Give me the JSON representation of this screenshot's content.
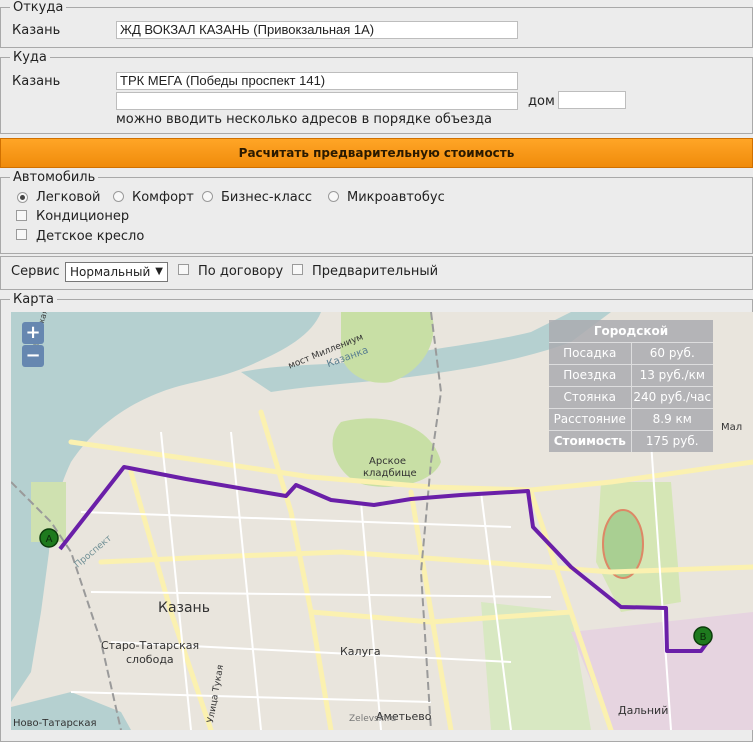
{
  "from": {
    "legend": "Откуда",
    "city": "Казань",
    "address": "ЖД ВОКЗАЛ КАЗАНЬ (Привокзальная 1А)"
  },
  "to": {
    "legend": "Куда",
    "city": "Казань",
    "address": "ТРК МЕГА (Победы проспект 141)",
    "address2": "",
    "house_label": "дом",
    "house_value": "",
    "hint": "можно вводить несколько адресов в порядке объезда"
  },
  "calc_button": "Расчитать предварительную стоимость",
  "car": {
    "legend": "Автомобиль",
    "options": [
      "Легковой",
      "Комфорт",
      "Бизнес-класс",
      "Микроавтобус"
    ],
    "selected": "Легковой",
    "extras": [
      "Кондиционер",
      "Детское кресло"
    ]
  },
  "service": {
    "label": "Сервис",
    "selected": "Нормальный",
    "contract": "По договору",
    "preliminary": "Предварительный"
  },
  "map": {
    "legend": "Карта",
    "zoom_in": "+",
    "zoom_out": "−",
    "tariff": {
      "title": "Городской",
      "rows": [
        {
          "name": "Посадка",
          "value": "60 руб."
        },
        {
          "name": "Поездка",
          "value": "13 руб./км"
        },
        {
          "name": "Стоянка",
          "value": "240 руб./час"
        },
        {
          "name": "Расстояние",
          "value": "8.9 км"
        },
        {
          "name": "Стоимость",
          "value": "175 руб."
        }
      ]
    },
    "marker_a": "A",
    "marker_b": "B",
    "labels": {
      "kazan": "Казань",
      "staro1": "Старо-Татарская",
      "staro2": "слобода",
      "arsk1": "Арское",
      "arsk2": "кладбище",
      "kaluga": "Калуга",
      "ametevo": "Аметьево",
      "dalniy": "Дальний",
      "kazanka": "Казанка",
      "bridge": "мост Миллениум",
      "lenin_dam": "Ленинская дамба",
      "mal": "Мал",
      "novo": "Ново-Татарская",
      "ulitsa": "Улица Тукая",
      "prostor": "Проспект",
      "attribution": "Zelevsk.ru"
    },
    "colors": {
      "route": "#6a1fa8",
      "markers": "#1e7a1e",
      "water": "#b4d0d1",
      "park": "#c8dfa5"
    }
  }
}
